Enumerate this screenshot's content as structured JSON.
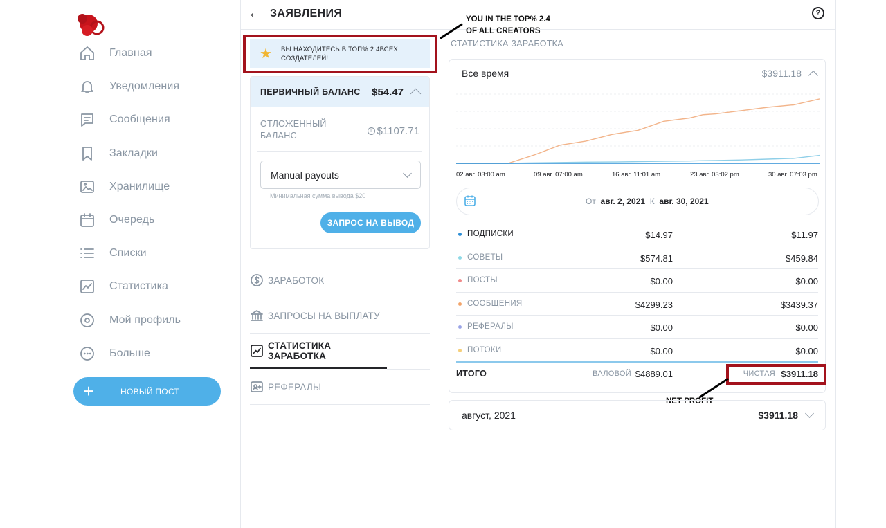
{
  "nav": {
    "items": [
      {
        "label": "Главная",
        "icon": "home-icon"
      },
      {
        "label": "Уведомления",
        "icon": "bell-icon"
      },
      {
        "label": "Сообщения",
        "icon": "message-icon"
      },
      {
        "label": "Закладки",
        "icon": "bookmark-icon"
      },
      {
        "label": "Хранилище",
        "icon": "vault-icon"
      },
      {
        "label": "Очередь",
        "icon": "calendar-icon"
      },
      {
        "label": "Списки",
        "icon": "list-icon"
      },
      {
        "label": "Статистика",
        "icon": "stats-icon"
      },
      {
        "label": "Мой профиль",
        "icon": "profile-icon"
      },
      {
        "label": "Больше",
        "icon": "more-icon"
      }
    ],
    "new_post": "НОВЫЙ ПОСТ"
  },
  "header": {
    "title": "ЗАЯВЛЕНИЯ"
  },
  "banner": {
    "line1": "ВЫ НАХОДИТЕСЬ В ТОП% 2.4ВСЕХ",
    "line2": "СОЗДАТЕЛЕЙ!"
  },
  "annotations": {
    "top_line1": "YOU IN THE TOP% 2.4",
    "top_line2": "OF ALL CREATORS",
    "net_profit": "NET PROFIT",
    "highlight_color": "#a3121c"
  },
  "balance": {
    "primary_label": "ПЕРВИЧНЫЙ БАЛАНС",
    "primary_value": "$54.47",
    "pending_line1": "ОТЛОЖЕННЫЙ",
    "pending_line2": "БАЛАНС",
    "pending_value": "$1107.71",
    "payout_select": "Manual payouts",
    "min_note": "Минимальная сумма вывода $20",
    "request_button": "ЗАПРОС НА ВЫВОД"
  },
  "submenu": [
    {
      "label": "ЗАРАБОТОК",
      "icon": "dollar-icon"
    },
    {
      "label": "ЗАПРОСЫ НА ВЫПЛАТУ",
      "icon": "bank-icon"
    },
    {
      "label": "СТАТИСТИКА ЗАРАБОТКА",
      "icon": "chart-icon",
      "active": true
    },
    {
      "label": "РЕФЕРАЛЫ",
      "icon": "referral-icon"
    }
  ],
  "stats": {
    "section_title": "СТАТИСТИКА ЗАРАБОТКА",
    "period_label": "Все время",
    "period_total": "$3911.18",
    "range_from_label": "От",
    "range_from": "авг. 2, 2021",
    "range_to_label": "К",
    "range_to": "авг. 30, 2021",
    "rows": [
      {
        "name": "ПОДПИСКИ",
        "gross": "$14.97",
        "net": "$11.97",
        "color": "#2f8fd6"
      },
      {
        "name": "СОВЕТЫ",
        "gross": "$574.81",
        "net": "$459.84",
        "color": "#8fd9e6"
      },
      {
        "name": "ПОСТЫ",
        "gross": "$0.00",
        "net": "$0.00",
        "color": "#f08a8a"
      },
      {
        "name": "СООБЩЕНИЯ",
        "gross": "$4299.23",
        "net": "$3439.37",
        "color": "#f2a46a"
      },
      {
        "name": "РЕФЕРАЛЫ",
        "gross": "$0.00",
        "net": "$0.00",
        "color": "#9aa4e6"
      },
      {
        "name": "ПОТОКИ",
        "gross": "$0.00",
        "net": "$0.00",
        "color": "#f5cf7a"
      }
    ],
    "total_label": "ИТОГО",
    "gross_label": "ВАЛОВОЙ",
    "gross_total": "$4889.01",
    "net_label": "ЧИСТАЯ",
    "net_total": "$3911.18"
  },
  "month": {
    "label": "август, 2021",
    "total": "$3911.18"
  },
  "chart_data": {
    "type": "line",
    "x_tick_labels": [
      "02 авг. 03:00 am",
      "09 авг. 07:00 am",
      "16 авг. 11:01 am",
      "23 авг. 03:02 pm",
      "30 авг. 07:03 pm"
    ],
    "x": [
      0,
      4,
      6,
      8,
      10,
      12,
      14,
      16,
      18,
      19,
      20,
      22,
      24,
      26,
      28
    ],
    "series": [
      {
        "color": "#f2b48a",
        "values": [
          0,
          0,
          0.5,
          1.1,
          1.35,
          1.75,
          2.0,
          2.55,
          2.75,
          2.95,
          3.0,
          3.2,
          3.4,
          3.55,
          3.91
        ]
      },
      {
        "color": "#8fcfe8",
        "values": [
          0,
          0,
          0.03,
          0.05,
          0.07,
          0.08,
          0.1,
          0.12,
          0.14,
          0.16,
          0.17,
          0.2,
          0.25,
          0.3,
          0.48
        ]
      },
      {
        "color": "#2f8fd6",
        "values": [
          0,
          0,
          0,
          0,
          0,
          0,
          0,
          0,
          0,
          0,
          0,
          0,
          0,
          0,
          0
        ]
      }
    ],
    "grid": true
  }
}
